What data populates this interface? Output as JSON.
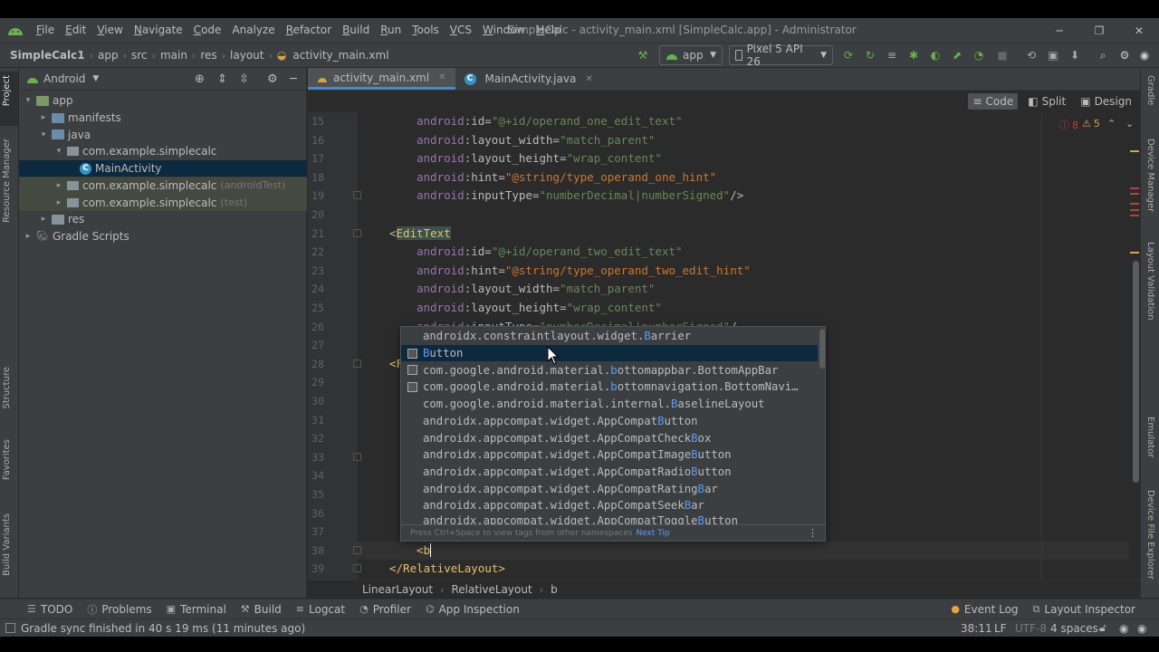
{
  "window": {
    "title": "SimpleCalc - activity_main.xml [SimpleCalc.app] - Administrator",
    "menu": [
      "File",
      "Edit",
      "View",
      "Navigate",
      "Code",
      "Analyze",
      "Refactor",
      "Build",
      "Run",
      "Tools",
      "VCS",
      "Window",
      "Help"
    ],
    "menu_mnemonic_first": [
      "F",
      "E",
      "V",
      "N",
      "C",
      "",
      "R",
      "B",
      "R",
      "T",
      "V",
      "W",
      "H"
    ],
    "controls": {
      "minimize": "─",
      "maximize": "❐",
      "close": "✕"
    }
  },
  "navbar": {
    "breadcrumbs": [
      "SimpleCalc1",
      "app",
      "src",
      "main",
      "res",
      "layout",
      "activity_main.xml"
    ],
    "run_config": "app",
    "device": "Pixel 5 API 26"
  },
  "project_panel": {
    "view_mode": "Android",
    "tree": [
      {
        "label": "app",
        "suffix": "",
        "depth": 0,
        "expanded": true,
        "icon": "folder-module"
      },
      {
        "label": "manifests",
        "suffix": "",
        "depth": 1,
        "expanded": false,
        "icon": "folder-blue"
      },
      {
        "label": "java",
        "suffix": "",
        "depth": 1,
        "expanded": true,
        "icon": "folder-blue"
      },
      {
        "label": "com.example.simplecalc",
        "suffix": "",
        "depth": 2,
        "expanded": true,
        "icon": "package"
      },
      {
        "label": "MainActivity",
        "suffix": "",
        "depth": 3,
        "expanded": false,
        "icon": "class",
        "selected": true
      },
      {
        "label": "com.example.simplecalc",
        "suffix": "(androidTest)",
        "depth": 2,
        "expanded": false,
        "icon": "package",
        "tinted": true
      },
      {
        "label": "com.example.simplecalc",
        "suffix": "(test)",
        "depth": 2,
        "expanded": false,
        "icon": "package",
        "tinted": true
      },
      {
        "label": "res",
        "suffix": "",
        "depth": 1,
        "expanded": false,
        "icon": "folder-res"
      },
      {
        "label": "Gradle Scripts",
        "suffix": "",
        "depth": 0,
        "expanded": false,
        "icon": "gradle"
      }
    ]
  },
  "left_strip": [
    "Project",
    "Resource Manager",
    "Structure",
    "Favorites",
    "Build Variants"
  ],
  "right_strip": [
    "Gradle",
    "Device Manager",
    "Layout Validation",
    "Emulator",
    "Device File Explorer"
  ],
  "editor_tabs": [
    {
      "label": "activity_main.xml",
      "active": true
    },
    {
      "label": "MainActivity.java",
      "active": false
    }
  ],
  "view_modes": [
    "Code",
    "Split",
    "Design"
  ],
  "inspections": {
    "errors": "8",
    "warnings": "5"
  },
  "code_lines": [
    {
      "n": "15",
      "html": "    <span class=\"a-ns\">android</span>:layout=\"\""
    },
    {
      "n": "16"
    },
    {
      "n": "17"
    },
    {
      "n": "18"
    },
    {
      "n": "19"
    },
    {
      "n": "20"
    },
    {
      "n": "21"
    },
    {
      "n": "22"
    },
    {
      "n": "23"
    },
    {
      "n": "24"
    },
    {
      "n": "25"
    },
    {
      "n": "26"
    },
    {
      "n": "27"
    },
    {
      "n": "28"
    },
    {
      "n": "29"
    },
    {
      "n": "30"
    },
    {
      "n": "31"
    },
    {
      "n": "32"
    },
    {
      "n": "33"
    },
    {
      "n": "34"
    },
    {
      "n": "35"
    },
    {
      "n": "36"
    },
    {
      "n": "37"
    },
    {
      "n": "38"
    },
    {
      "n": "39"
    }
  ],
  "code": [
    {
      "n": "15",
      "indent": "    ",
      "attr": "id",
      "val": "\"@+id/operand_one_edit_text\""
    },
    {
      "n": "16",
      "indent": "    ",
      "attr": "layout_width",
      "val": "\"match_parent\""
    },
    {
      "n": "17",
      "indent": "    ",
      "attr": "layout_height",
      "val": "\"wrap_content\""
    },
    {
      "n": "18",
      "indent": "    ",
      "attr": "hint",
      "val": "\"@string/type_operand_one_hint\"",
      "res": true
    },
    {
      "n": "19",
      "indent": "    ",
      "attr": "inputType",
      "val": "\"numberDecimal|numberSigned\"",
      "tail": "/>"
    },
    {
      "n": "20",
      "blank": true
    },
    {
      "n": "21",
      "tag": "EditText"
    },
    {
      "n": "22",
      "indent": "    ",
      "attr": "id",
      "val": "\"@+id/operand_two_edit_text\""
    },
    {
      "n": "23",
      "indent": "    ",
      "attr": "hint",
      "val": "\"@string/type_operand_two_edit_hint\"",
      "res": true
    },
    {
      "n": "24",
      "indent": "    ",
      "attr": "layout_width",
      "val": "\"match_parent\""
    },
    {
      "n": "25",
      "indent": "    ",
      "attr": "layout_height",
      "val": "\"wrap_content\""
    },
    {
      "n": "26",
      "indent": "    ",
      "attr": "inputType",
      "val": "\"numberDecimal|numberSigned\"",
      "tail": "/"
    },
    {
      "n": "27",
      "blank": true
    },
    {
      "n": "28",
      "partial": "<F"
    },
    {
      "n": "29",
      "blank": true
    },
    {
      "n": "30",
      "blank": true
    },
    {
      "n": "31",
      "blank": true
    },
    {
      "n": "32",
      "blank": true
    },
    {
      "n": "33",
      "blank": true
    },
    {
      "n": "34",
      "blank": true
    },
    {
      "n": "35",
      "blank": true
    },
    {
      "n": "36",
      "blank": true
    },
    {
      "n": "37",
      "blank": true
    },
    {
      "n": "38",
      "typed": "<b"
    },
    {
      "n": "39",
      "close": "</RelativeLayout>"
    }
  ],
  "completion": {
    "items": [
      {
        "pre": "androidx.constraintlayout.widget.",
        "hl": "B",
        "post": "arrier",
        "icon": false
      },
      {
        "pre": "",
        "hl": "B",
        "post": "utton",
        "icon": true,
        "selected": true
      },
      {
        "pre": "com.google.android.material.",
        "hl": "b",
        "post": "ottomappbar.BottomAppBar",
        "icon": true
      },
      {
        "pre": "com.google.android.material.",
        "hl": "b",
        "post": "ottomnavigation.BottomNavi…",
        "icon": true
      },
      {
        "pre": "com.google.android.material.internal.",
        "hl": "B",
        "post": "aselineLayout",
        "icon": false
      },
      {
        "pre": "androidx.appcompat.widget.AppCompat",
        "hl": "B",
        "post": "utton",
        "icon": false
      },
      {
        "pre": "androidx.appcompat.widget.AppCompatCheck",
        "hl": "B",
        "post": "ox",
        "icon": false
      },
      {
        "pre": "androidx.appcompat.widget.AppCompatImage",
        "hl": "B",
        "post": "utton",
        "icon": false
      },
      {
        "pre": "androidx.appcompat.widget.AppCompatRadio",
        "hl": "B",
        "post": "utton",
        "icon": false
      },
      {
        "pre": "androidx.appcompat.widget.AppCompatRating",
        "hl": "B",
        "post": "ar",
        "icon": false
      },
      {
        "pre": "androidx.appcompat.widget.AppCompatSeek",
        "hl": "B",
        "post": "ar",
        "icon": false
      },
      {
        "pre": "androidx.appcompat.widget.AppCompatToggle",
        "hl": "B",
        "post": "utton",
        "icon": false
      }
    ],
    "footer_hint": "Press Ctrl+Space to view tags from other namespaces",
    "footer_link": "Next Tip"
  },
  "editor_breadcrumb": [
    "LinearLayout",
    "RelativeLayout",
    "b"
  ],
  "tool_windows": [
    {
      "label": "TODO",
      "icon": "list-icon"
    },
    {
      "label": "Problems",
      "icon": "problems-icon"
    },
    {
      "label": "Terminal",
      "icon": "terminal-icon"
    },
    {
      "label": "Build",
      "icon": "hammer-icon"
    },
    {
      "label": "Logcat",
      "icon": "logcat-icon"
    },
    {
      "label": "Profiler",
      "icon": "profiler-icon"
    },
    {
      "label": "App Inspection",
      "icon": "inspection-icon"
    }
  ],
  "tool_windows_right": [
    {
      "label": "Event Log",
      "icon": "event-log-icon"
    },
    {
      "label": "Layout Inspector",
      "icon": "layout-inspector-icon"
    }
  ],
  "status": {
    "message": "Gradle sync finished in 40 s 19 ms (11 minutes ago)",
    "position": "38:11",
    "line_sep": "LF",
    "encoding": "UTF-8",
    "indent": "4 spaces"
  },
  "colors": {
    "accent": "#4a88c7",
    "selection": "#0d293e",
    "error": "#bc3f3c",
    "warning": "#d9a343"
  }
}
